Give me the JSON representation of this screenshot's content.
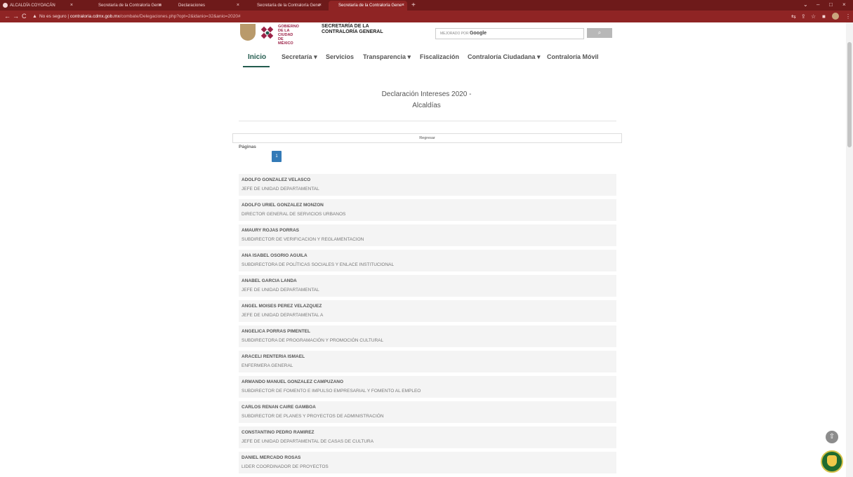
{
  "browser": {
    "tabs": [
      {
        "label": "ALCALDÍA COYOACÁN"
      },
      {
        "label": "Secretaría de la Contraloría Gene"
      },
      {
        "label": "Declaraciones"
      },
      {
        "label": ""
      },
      {
        "label": "Secretaría de la Contraloría Gene"
      },
      {
        "label": "Secretaría de la Contraloría Gene"
      }
    ],
    "new_tab": "+",
    "security_warning": "No es seguro",
    "url_host": "contraloria.cdmx.gob.mx",
    "url_path": "/combate/Delegaciones.php?opt=2&idanio=32&anio=2020#"
  },
  "header": {
    "gov_name_line1": "GOBIERNO DE LA",
    "gov_name_line2": "CIUDAD DE MÉXICO",
    "secretaria_line1": "SECRETARÍA DE LA",
    "secretaria_line2": "CONTRALORÍA GENERAL",
    "search_powered": "MEJORADO POR",
    "search_brand": "Google",
    "search_button_icon": "search-icon"
  },
  "nav": {
    "items": [
      {
        "label": "Inicio"
      },
      {
        "label": "Secretaría"
      },
      {
        "label": "Servicios"
      },
      {
        "label": "Transparencia"
      },
      {
        "label": "Fiscalización"
      },
      {
        "label": "Contraloría Ciudadana"
      },
      {
        "label": "Contraloría Móvil"
      }
    ],
    "dropdown_marker": "▾"
  },
  "main": {
    "title": "Declaración Intereses 2020 -",
    "subtitle": "Alcaldías",
    "back_button": "Regresar",
    "pages_label": "Páginas",
    "current_page": "1",
    "people": [
      {
        "name": "ADOLFO GONZALEZ VELASCO",
        "position": "JEFE DE UNIDAD DEPARTAMENTAL"
      },
      {
        "name": "ADOLFO URIEL GONZALEZ MONZON",
        "position": "DIRECTOR GENERAL DE SERVICIOS URBANOS"
      },
      {
        "name": "AMAURY ROJAS PORRAS",
        "position": "SUBDIRECTOR DE VERIFICACION Y REGLAMENTACION"
      },
      {
        "name": "ANA ISABEL OSORIO AGUILA",
        "position": "SUBDIRECTORA DE POLÍTICAS SOCIALES Y ENLACE INSTITUCIONAL"
      },
      {
        "name": "ANABEL GARCIA LANDA",
        "position": "JEFE DE UNIDAD DEPARTAMENTAL"
      },
      {
        "name": "ANGEL MOISES PEREZ VELAZQUEZ",
        "position": "JEFE DE UNIDAD DEPARTAMENTAL A"
      },
      {
        "name": "ANGELICA PORRAS PIMENTEL",
        "position": "SUBDIRECTORA DE PROGRAMACIÓN Y PROMOCIÓN CULTURAL"
      },
      {
        "name": "ARACELI RENTERIA ISMAEL",
        "position": "ENFERMERA GENERAL"
      },
      {
        "name": "ARMANDO MANUEL GONZALEZ CAMPUZANO",
        "position": "SUBDIRECTOR DE FOMENTO E IMPULSO EMPRESARIAL Y FOMENTO AL EMPLEO"
      },
      {
        "name": "CARLOS RENAN CAIRE GAMBOA",
        "position": "SUBDIRECTOR DE PLANES Y PROYECTOS DE ADMINISTRACIÓN"
      },
      {
        "name": "CONSTANTINO PEDRO RAMIREZ",
        "position": "JEFE DE UNIDAD DEPARTAMENTAL DE CASAS DE CULTURA"
      },
      {
        "name": "DANIEL MERCADO ROSAS",
        "position": "LIDER COORDINADOR DE PROYECTOS"
      }
    ]
  },
  "colors": {
    "browser_frame": "#8f2424",
    "nav_active": "#235b4e",
    "page_button": "#337ab7",
    "item_bg": "#f4f4f4"
  }
}
